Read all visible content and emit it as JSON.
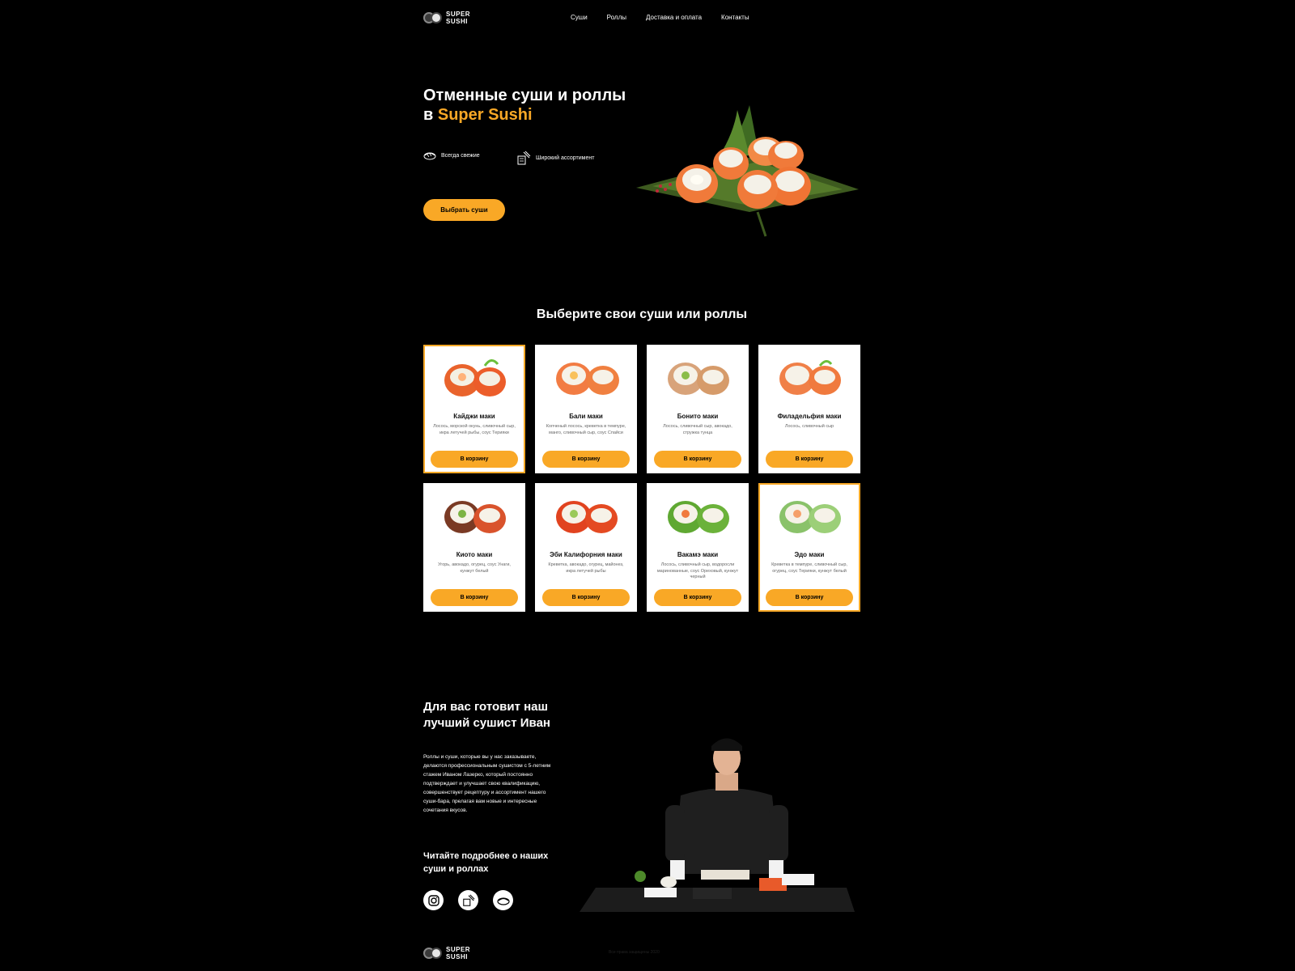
{
  "brand": {
    "line1": "SUPER",
    "line2": "SUSHI"
  },
  "nav": [
    {
      "label": "Суши"
    },
    {
      "label": "Роллы"
    },
    {
      "label": "Доставка и оплата"
    },
    {
      "label": "Контакты"
    }
  ],
  "hero": {
    "title_line1": "Отменные суши и роллы",
    "title_prefix": "в ",
    "title_accent": "Super Sushi",
    "features": [
      {
        "icon": "sushi-icon",
        "label": "Всегда свежие"
      },
      {
        "icon": "chopsticks-icon",
        "label": "Широкий ассортимент"
      }
    ],
    "cta_label": "Выбрать суши"
  },
  "menu": {
    "title": "Выберите свои суши или роллы",
    "button_label": "В корзину",
    "items": [
      {
        "name": "Кайджи маки",
        "desc": "Лосось, морской окунь, сливочный сыр, икра летучей рыбы, соус Терияки",
        "highlight": true
      },
      {
        "name": "Бали маки",
        "desc": "Копченый лосось, креветка в темпуре, манго, сливочный сыр, соус Спайси",
        "highlight": false
      },
      {
        "name": "Бонито маки",
        "desc": "Лосось, сливочный сыр, авокадо, стружка тунца",
        "highlight": false
      },
      {
        "name": "Филадельфия маки",
        "desc": "Лосось, сливочный сыр",
        "highlight": false
      },
      {
        "name": "Киото маки",
        "desc": "Угорь, авокадо, огурец, соус Унаги, кунжут белый",
        "highlight": false
      },
      {
        "name": "Эби Калифорния маки",
        "desc": "Креветка, авокадо, огурец, майонез, икра летучей рыбы",
        "highlight": false
      },
      {
        "name": "Вакамэ маки",
        "desc": "Лосось, сливочный сыр, водоросли маринованные, соус Ореховый, кунжут черный",
        "highlight": false
      },
      {
        "name": "Эдо маки",
        "desc": "Креветка в темпуре, сливочный сыр, огурец, соус Терияки, кунжут белый",
        "highlight": true
      }
    ]
  },
  "chef": {
    "title_line1": "Для вас готовит наш",
    "title_line2": "лучший сушист Иван",
    "text": "Роллы и суши, которые вы у нас заказываете, делаются профессиональным сушистом с 5-летним стажем Иваном Лазерко, который постоянно подтверждает и улучшает свою квалификацию, совершенствует рецептуру и ассортимент нашего суши-бара, прелагая вам новые и интересные сочетания вкусов.",
    "read_more_line1": "Читайте подробнее о наших",
    "read_more_line2": "суши и роллах",
    "socials": [
      "instagram-icon",
      "chopsticks-icon",
      "sushi-icon"
    ]
  },
  "footer": {
    "copyright": "Все права защищены 2020"
  },
  "colors": {
    "accent": "#f9a826",
    "background": "#000000",
    "card": "#ffffff"
  }
}
